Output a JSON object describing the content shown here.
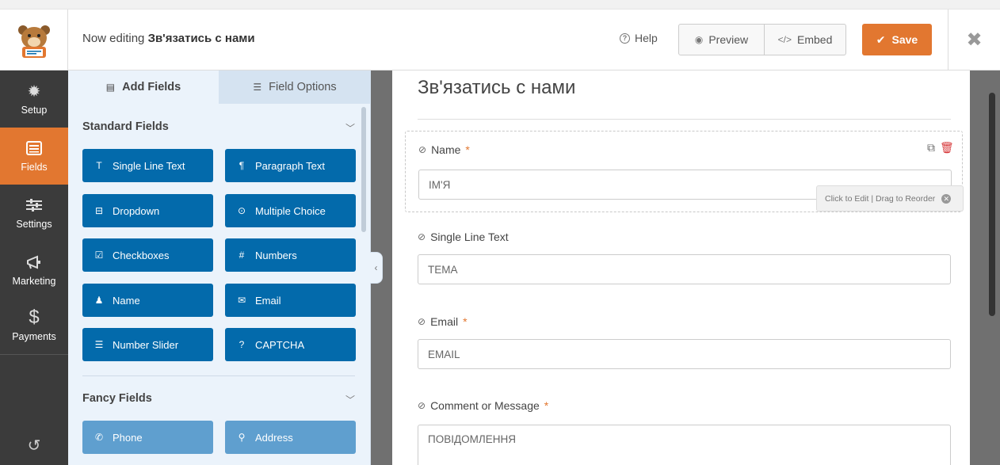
{
  "toolbar": {
    "now_editing_prefix": "Now editing",
    "form_name": "Зв'язатись с нами",
    "help_label": "Help",
    "preview_label": "Preview",
    "embed_label": "Embed",
    "save_label": "Save"
  },
  "leftnav": {
    "items": [
      {
        "label": "Setup",
        "icon": "gear-icon"
      },
      {
        "label": "Fields",
        "icon": "fields-icon",
        "active": true
      },
      {
        "label": "Settings",
        "icon": "sliders-icon"
      },
      {
        "label": "Marketing",
        "icon": "megaphone-icon"
      },
      {
        "label": "Payments",
        "icon": "dollar-icon"
      }
    ]
  },
  "panel": {
    "tabs": [
      {
        "label": "Add Fields",
        "active": true
      },
      {
        "label": "Field Options",
        "active": false
      }
    ],
    "standard_title": "Standard Fields",
    "standard_fields": [
      {
        "label": "Single Line Text",
        "icon": "text-icon"
      },
      {
        "label": "Paragraph Text",
        "icon": "paragraph-icon"
      },
      {
        "label": "Dropdown",
        "icon": "dropdown-icon"
      },
      {
        "label": "Multiple Choice",
        "icon": "radio-icon"
      },
      {
        "label": "Checkboxes",
        "icon": "checkbox-icon"
      },
      {
        "label": "Numbers",
        "icon": "hash-icon"
      },
      {
        "label": "Name",
        "icon": "user-icon"
      },
      {
        "label": "Email",
        "icon": "envelope-icon"
      },
      {
        "label": "Number Slider",
        "icon": "sliders-icon"
      },
      {
        "label": "CAPTCHA",
        "icon": "question-icon"
      }
    ],
    "fancy_title": "Fancy Fields",
    "fancy_fields": [
      {
        "label": "Phone",
        "icon": "phone-icon"
      },
      {
        "label": "Address",
        "icon": "map-pin-icon"
      }
    ]
  },
  "form": {
    "title": "Зв'язатись с нами",
    "edit_hint": "Click to Edit | Drag to Reorder",
    "fields": [
      {
        "label": "Name",
        "required": "*",
        "placeholder": "ІМ'Я"
      },
      {
        "label": "Single Line Text",
        "required": "",
        "placeholder": "ТЕМА"
      },
      {
        "label": "Email",
        "required": "*",
        "placeholder": "EMAIL"
      },
      {
        "label": "Comment or Message",
        "required": "*",
        "placeholder": "ПОВІДОМЛЕННЯ"
      }
    ]
  },
  "colors": {
    "accent": "#e27730",
    "field_button": "#036aab",
    "fancy_button": "#5f9fcf",
    "nav_bg": "#3b3b3b",
    "panel_bg": "#ebf3fb"
  }
}
